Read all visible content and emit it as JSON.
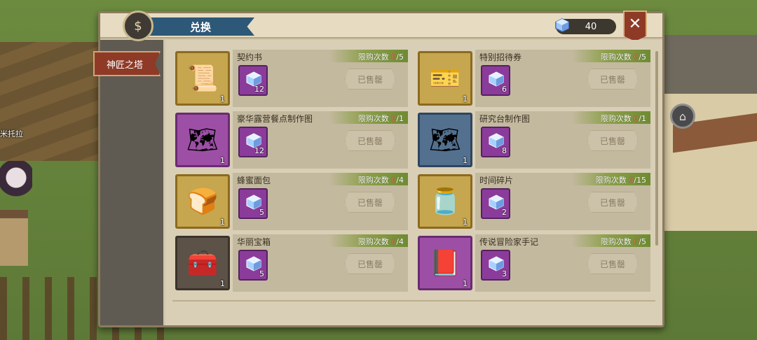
{
  "npc_name": "米托拉",
  "dialog": {
    "title": "兑换",
    "currency_amount": "40",
    "close_label": "✕",
    "sidebar_tab": "神匠之塔"
  },
  "items": [
    {
      "name": "契约书",
      "limit_label": "限购次数",
      "used": "0",
      "max": "/5",
      "thumb_qty": "1",
      "cost": "12",
      "status": "已售罄",
      "frame": "gold",
      "icon": "scroll-icon",
      "glyph": "📜"
    },
    {
      "name": "特别招待券",
      "limit_label": "限购次数",
      "used": "0",
      "max": "/5",
      "thumb_qty": "1",
      "cost": "6",
      "status": "已售罄",
      "frame": "gold",
      "icon": "ticket-icon",
      "glyph": "🎫"
    },
    {
      "name": "豪华露营餐点制作图",
      "limit_label": "限购次数",
      "used": "0",
      "max": "/1",
      "thumb_qty": "1",
      "cost": "12",
      "status": "已售罄",
      "frame": "purple",
      "icon": "blueprint-food-icon",
      "glyph": "🗺"
    },
    {
      "name": "研究台制作图",
      "limit_label": "限购次数",
      "used": "0",
      "max": "/1",
      "thumb_qty": "1",
      "cost": "8",
      "status": "已售罄",
      "frame": "blue",
      "icon": "blueprint-desk-icon",
      "glyph": "🗺"
    },
    {
      "name": "蜂蜜面包",
      "limit_label": "限购次数",
      "used": "0",
      "max": "/4",
      "thumb_qty": "1",
      "cost": "5",
      "status": "已售罄",
      "frame": "gold",
      "icon": "bread-icon",
      "glyph": "🍞"
    },
    {
      "name": "时间碎片",
      "limit_label": "限购次数",
      "used": "0",
      "max": "/15",
      "thumb_qty": "1",
      "cost": "2",
      "status": "已售罄",
      "frame": "gold",
      "icon": "jar-icon",
      "glyph": "🫙"
    },
    {
      "name": "华丽宝箱",
      "limit_label": "限购次数",
      "used": "0",
      "max": "/4",
      "thumb_qty": "1",
      "cost": "5",
      "status": "已售罄",
      "frame": "dark",
      "icon": "chest-icon",
      "glyph": "🧰"
    },
    {
      "name": "传说冒险家手记",
      "limit_label": "限购次数",
      "used": "0",
      "max": "/5",
      "thumb_qty": "1",
      "cost": "3",
      "status": "已售罄",
      "frame": "purple",
      "icon": "notebook-icon",
      "glyph": "📕"
    }
  ]
}
